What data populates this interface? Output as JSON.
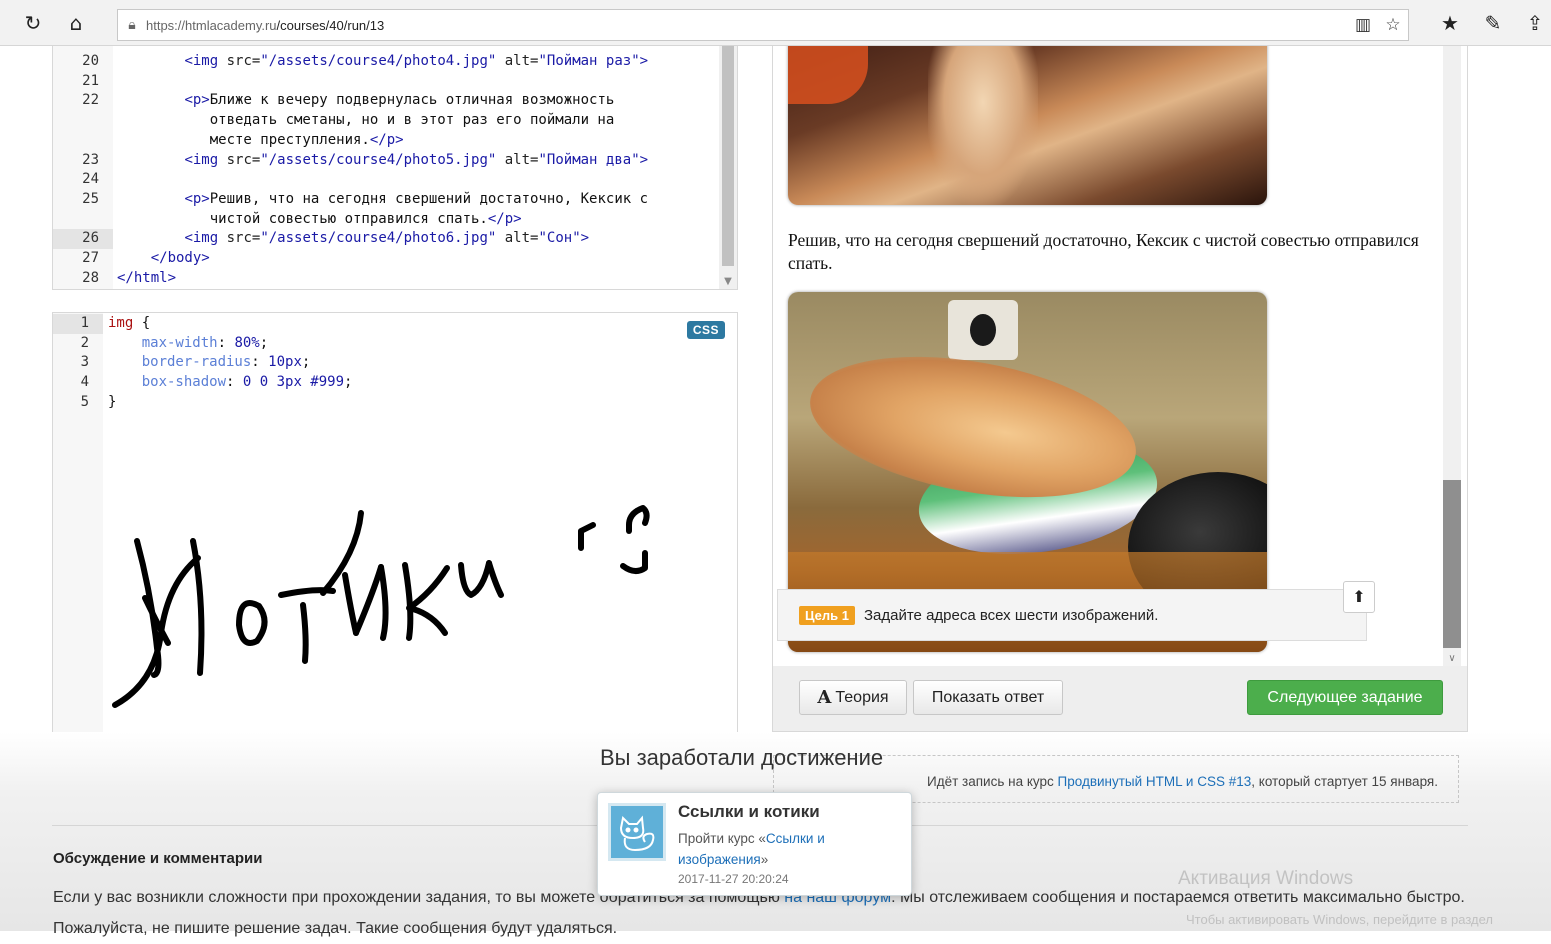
{
  "browser": {
    "url_host": "https://htmlacademy.ru",
    "url_path": "/courses/40/run/13",
    "icons": [
      "refresh-icon",
      "home-icon",
      "lock-icon",
      "reading-view-icon",
      "favorite-star-icon",
      "favorites-list-icon",
      "pen-icon",
      "share-icon"
    ]
  },
  "html_editor": {
    "lines": [
      {
        "num": "20",
        "segments": [
          {
            "t": "        ",
            "c": ""
          },
          {
            "t": "<img",
            "c": "tag"
          },
          {
            "t": " src=",
            "c": "attr"
          },
          {
            "t": "\"/assets/course4/photo4.jpg\"",
            "c": "str"
          },
          {
            "t": " alt=",
            "c": "attr"
          },
          {
            "t": "\"Пойман раз\"",
            "c": "str"
          },
          {
            "t": ">",
            "c": "tag"
          }
        ]
      },
      {
        "num": "21",
        "segments": []
      },
      {
        "num": "22",
        "segments": [
          {
            "t": "        ",
            "c": ""
          },
          {
            "t": "<p>",
            "c": "tag"
          },
          {
            "t": "Ближе к вечеру подвернулась отличная возможность",
            "c": ""
          }
        ]
      },
      {
        "num": "",
        "segments": [
          {
            "t": "           отведать сметаны, но и в этот раз его поймали на",
            "c": ""
          }
        ]
      },
      {
        "num": "",
        "segments": [
          {
            "t": "           месте преступления.",
            "c": ""
          },
          {
            "t": "</p>",
            "c": "tag"
          }
        ]
      },
      {
        "num": "23",
        "segments": [
          {
            "t": "        ",
            "c": ""
          },
          {
            "t": "<img",
            "c": "tag"
          },
          {
            "t": " src=",
            "c": "attr"
          },
          {
            "t": "\"/assets/course4/photo5.jpg\"",
            "c": "str"
          },
          {
            "t": " alt=",
            "c": "attr"
          },
          {
            "t": "\"Пойман два\"",
            "c": "str"
          },
          {
            "t": ">",
            "c": "tag"
          }
        ]
      },
      {
        "num": "24",
        "segments": []
      },
      {
        "num": "25",
        "segments": [
          {
            "t": "        ",
            "c": ""
          },
          {
            "t": "<p>",
            "c": "tag"
          },
          {
            "t": "Решив, что на сегодня свершений достаточно, Кексик с",
            "c": ""
          }
        ]
      },
      {
        "num": "",
        "segments": [
          {
            "t": "           чистой совестью отправился спать.",
            "c": ""
          },
          {
            "t": "</p>",
            "c": "tag"
          }
        ]
      },
      {
        "num": "26",
        "active": true,
        "segments": [
          {
            "t": "        ",
            "c": ""
          },
          {
            "t": "<img",
            "c": "tag"
          },
          {
            "t": " src=",
            "c": "attr"
          },
          {
            "t": "\"/assets/course4/photo6.jpg\"",
            "c": "str"
          },
          {
            "t": " alt=",
            "c": "attr"
          },
          {
            "t": "\"Сон\"",
            "c": "str"
          },
          {
            "t": ">",
            "c": "tag"
          }
        ]
      },
      {
        "num": "27",
        "segments": [
          {
            "t": "    ",
            "c": ""
          },
          {
            "t": "</body>",
            "c": "tag"
          }
        ]
      },
      {
        "num": "28",
        "segments": [
          {
            "t": "</html>",
            "c": "tag"
          }
        ]
      }
    ]
  },
  "css_editor": {
    "badge": "CSS",
    "lines": [
      {
        "num": "1",
        "active": true,
        "segments": [
          {
            "t": "img",
            "c": "selector"
          },
          {
            "t": " {",
            "c": ""
          }
        ]
      },
      {
        "num": "2",
        "segments": [
          {
            "t": "    ",
            "c": ""
          },
          {
            "t": "max-width",
            "c": "prop"
          },
          {
            "t": ": ",
            "c": ""
          },
          {
            "t": "80%",
            "c": "num"
          },
          {
            "t": ";",
            "c": ""
          }
        ]
      },
      {
        "num": "3",
        "segments": [
          {
            "t": "    ",
            "c": ""
          },
          {
            "t": "border-radius",
            "c": "prop"
          },
          {
            "t": ": ",
            "c": ""
          },
          {
            "t": "10px",
            "c": "num"
          },
          {
            "t": ";",
            "c": ""
          }
        ]
      },
      {
        "num": "4",
        "segments": [
          {
            "t": "    ",
            "c": ""
          },
          {
            "t": "box-shadow",
            "c": "prop"
          },
          {
            "t": ": ",
            "c": ""
          },
          {
            "t": "0 0 3px #999",
            "c": "num"
          },
          {
            "t": ";",
            "c": ""
          }
        ]
      },
      {
        "num": "5",
        "segments": [
          {
            "t": "}",
            "c": ""
          }
        ]
      }
    ],
    "handwriting": "Котики :-)"
  },
  "preview": {
    "paragraph": "Решив, что на сегодня свершений достаточно, Кексик с чистой совестью отправился спать.",
    "goal_badge": "Цель 1",
    "goal_text": "Задайте адреса всех шести изображений.",
    "buttons": {
      "theory": "Теория",
      "theory_icon": "A",
      "show_answer": "Показать ответ",
      "next": "Следующее задание"
    }
  },
  "achievement": {
    "heading": "Вы заработали достижение",
    "title": "Ссылки и котики",
    "desc_prefix": "Пройти курс «",
    "desc_link": "Ссылки и изображения",
    "desc_suffix": "»",
    "date": "2017-11-27 20:20:24"
  },
  "enroll": {
    "prefix": "Идёт запись на курс ",
    "link": "Продвинутый HTML и CSS #13",
    "suffix": ", который стартует 15 января."
  },
  "discussion": {
    "title": "Обсуждение и комментарии",
    "line1_a": "Если у вас возникли сложности при прохождении задания, то вы можете обратиться за помощью ",
    "line1_link": "на наш форум",
    "line1_b": ". Мы отслеживаем сообщения и постараемся ответить максимально быстро.",
    "line2": "Пожалуйста, не пишите решение задач. Такие сообщения будут удаляться."
  },
  "watermark": {
    "line1": "Активация Windows",
    "line2": "Чтобы активировать Windows, перейдите в раздел"
  },
  "colors": {
    "next_button": "#4cae4c",
    "goal_badge": "#f0a01f",
    "css_badge": "#2d79a1",
    "link": "#1d6fb8"
  }
}
